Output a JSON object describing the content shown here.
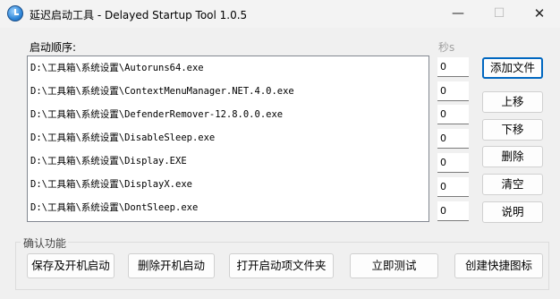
{
  "window": {
    "title": "延迟启动工具 - Delayed Startup Tool 1.0.5",
    "minimize": "—",
    "maximize": "☐",
    "close": "✕"
  },
  "labels": {
    "startup_order": "启动顺序:",
    "seconds": "秒s",
    "confirm_group": "确认功能"
  },
  "list": [
    "D:\\工具箱\\系统设置\\Autoruns64.exe",
    "D:\\工具箱\\系统设置\\ContextMenuManager.NET.4.0.exe",
    "D:\\工具箱\\系统设置\\DefenderRemover-12.8.0.0.exe",
    "D:\\工具箱\\系统设置\\DisableSleep.exe",
    "D:\\工具箱\\系统设置\\Display.EXE",
    "D:\\工具箱\\系统设置\\DisplayX.exe",
    "D:\\工具箱\\系统设置\\DontSleep.exe"
  ],
  "seconds_values": [
    "0",
    "0",
    "0",
    "0",
    "0",
    "0",
    "0"
  ],
  "side_buttons": {
    "add_file": "添加文件",
    "move_up": "上移",
    "move_down": "下移",
    "delete": "删除",
    "clear": "清空",
    "help": "说明"
  },
  "bottom_buttons": {
    "save_enable": "保存及开机启动",
    "delete_startup": "删除开机启动",
    "open_folder": "打开启动项文件夹",
    "test_now": "立即测试",
    "create_shortcut": "创建快捷图标"
  },
  "colors": {
    "accent": "#0067c0",
    "background": "#f0f0f0",
    "disabled_text": "#a0a0a0"
  }
}
